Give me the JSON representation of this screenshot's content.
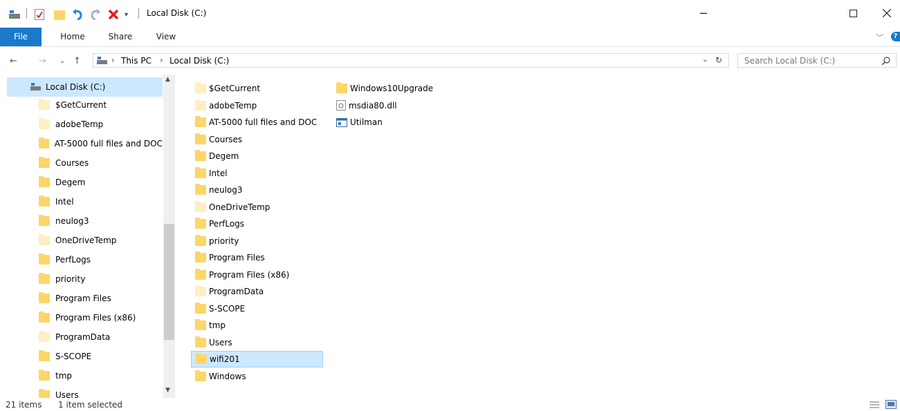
{
  "window": {
    "title": "Local Disk (C:)"
  },
  "ribbon": {
    "tabs": [
      "File",
      "Home",
      "Share",
      "View"
    ]
  },
  "address": {
    "crumbs": [
      "This PC",
      "Local Disk (C:)"
    ]
  },
  "search": {
    "placeholder": "Search Local Disk (C:)"
  },
  "nav_pane": {
    "root": "Local Disk (C:)",
    "items": [
      "$GetCurrent",
      "adobeTemp",
      "AT-5000 full files and DOC",
      "Courses",
      "Degem",
      "Intel",
      "neulog3",
      "OneDriveTemp",
      "PerfLogs",
      "priority",
      "Program Files",
      "Program Files (x86)",
      "ProgramData",
      "S-SCOPE",
      "tmp",
      "Users"
    ]
  },
  "content": {
    "col1": [
      "$GetCurrent",
      "adobeTemp",
      "AT-5000 full files and DOC",
      "Courses",
      "Degem",
      "Intel",
      "neulog3",
      "OneDriveTemp",
      "PerfLogs",
      "priority",
      "Program Files",
      "Program Files (x86)",
      "ProgramData",
      "S-SCOPE",
      "tmp",
      "Users",
      "wifi201",
      "Windows"
    ],
    "col2": [
      "Windows10Upgrade",
      "msdia80.dll",
      "Utilman"
    ],
    "selected": "wifi201"
  },
  "status": {
    "item_count": "21 items",
    "selection": "1 item selected"
  },
  "colors": {
    "accent": "#1979ca",
    "selection": "#cce8ff",
    "folder": "#fdd66a"
  }
}
